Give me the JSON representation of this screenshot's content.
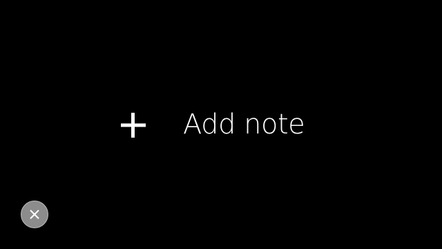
{
  "main": {
    "add_note": {
      "label": "Add note",
      "icon": "plus-icon"
    }
  },
  "footer": {
    "close_button": {
      "icon": "close-icon"
    }
  },
  "colors": {
    "background": "#000000",
    "text": "#ffffff",
    "close_button_fill": "#8c8c8c"
  }
}
